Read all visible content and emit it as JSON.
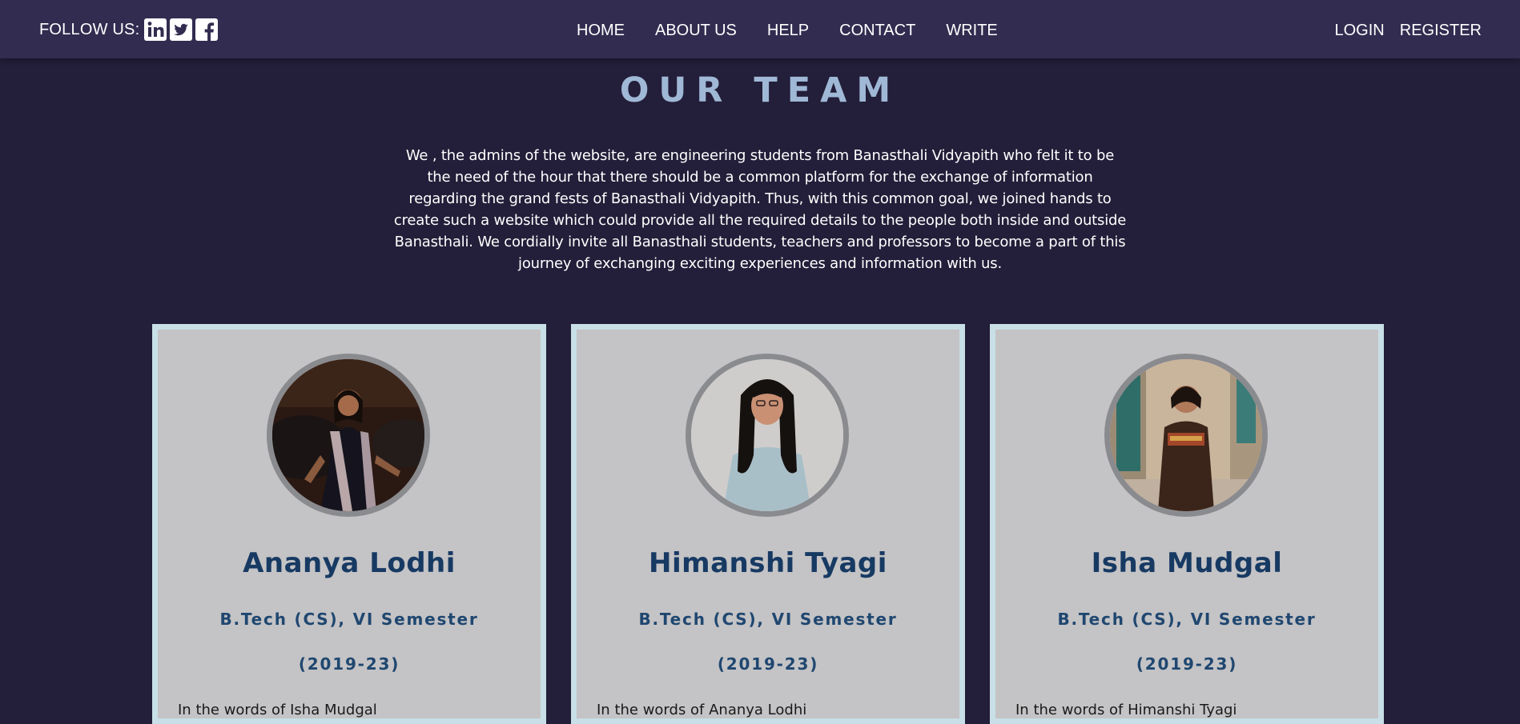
{
  "nav": {
    "follow_label": "FOLLOW US:",
    "social": [
      {
        "icon": "linkedin-icon"
      },
      {
        "icon": "twitter-icon"
      },
      {
        "icon": "facebook-icon"
      }
    ],
    "menu": [
      "HOME",
      "ABOUT US",
      "HELP",
      "CONTACT",
      "WRITE"
    ],
    "login": "LOGIN",
    "register": "REGISTER"
  },
  "heading": "OUR TEAM",
  "intro": "We , the admins of the website, are engineering students from Banasthali Vidyapith who felt it to be the need of the hour that there should be a common platform for the exchange of information regarding the grand fests of Banasthali Vidyapith. Thus, with this common goal, we joined hands to create such a website which could provide all the required details to the people both inside and outside Banasthali. We cordially invite all Banasthali students, teachers and professors to become a part of this journey of exchanging exciting experiences and information with us.",
  "team": [
    {
      "name": "Ananya Lodhi",
      "course": "B.Tech (CS), VI Semester",
      "years": "(2019-23)",
      "quote": "In the words of Isha Mudgal"
    },
    {
      "name": "Himanshi Tyagi",
      "course": "B.Tech (CS), VI Semester",
      "years": "(2019-23)",
      "quote": "In the words of Ananya Lodhi"
    },
    {
      "name": "Isha Mudgal",
      "course": "B.Tech (CS), VI Semester",
      "years": "(2019-23)",
      "quote": "In the words of Himanshi Tyagi"
    }
  ],
  "colors": {
    "page_bg": "#231e39",
    "nav_bg": "#322c50",
    "heading": "#9fb8d6",
    "card_bg": "#c4c3c5",
    "card_border": "#c8dfe7",
    "name": "#173a63"
  }
}
